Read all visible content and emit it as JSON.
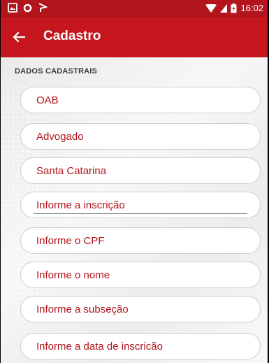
{
  "status_bar": {
    "time": "16:02",
    "icons": [
      "gallery-icon",
      "circle-icon",
      "flag-icon",
      "wifi-icon",
      "signal-icon",
      "battery-icon"
    ]
  },
  "app_bar": {
    "title": "Cadastro",
    "back_icon": "arrow-left-icon"
  },
  "section": {
    "title": "DADOS CADASTRAIS"
  },
  "fields": {
    "type": "OAB",
    "role": "Advogado",
    "state": "Santa Catarina",
    "inscricao_placeholder": "Informe a inscrição",
    "cpf_placeholder": "Informe o CPF",
    "nome_placeholder": "Informe o nome",
    "subsecao_placeholder": "Informe a subseção",
    "data_placeholder": "Informe a data de inscricão"
  },
  "colors": {
    "accent": "#c4161c",
    "status_bar": "#b3151c",
    "field_text": "#b3151c"
  }
}
